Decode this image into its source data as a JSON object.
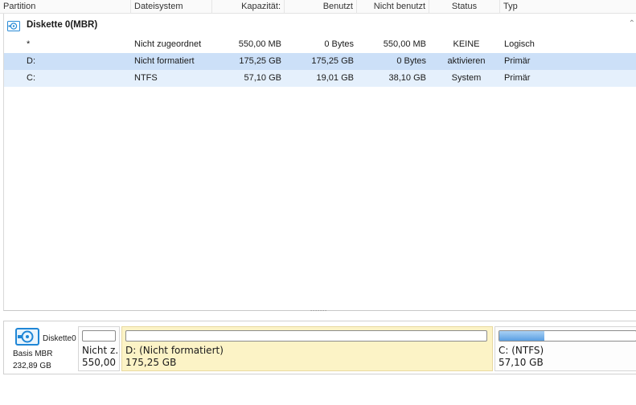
{
  "columns": [
    "Partition",
    "Dateisystem",
    "Kapazität:",
    "Benutzt",
    "Nicht benutzt",
    "Status",
    "Typ"
  ],
  "disk": {
    "title": "Diskette 0(MBR)",
    "icon": "disk-icon",
    "collapse_glyph": "⌃"
  },
  "rows": [
    {
      "partition": "*",
      "filesystem": "Nicht zugeordnet",
      "capacity": "550,00 MB",
      "used": "0 Bytes",
      "free": "550,00 MB",
      "status": "KEINE",
      "type": "Logisch"
    },
    {
      "partition": "D:",
      "filesystem": "Nicht formatiert",
      "capacity": "175,25 GB",
      "used": "175,25 GB",
      "free": "0 Bytes",
      "status": "aktivieren",
      "type": "Primär"
    },
    {
      "partition": "C:",
      "filesystem": "NTFS",
      "capacity": "57,10 GB",
      "used": "19,01 GB",
      "free": "38,10 GB",
      "status": "System",
      "type": "Primär"
    }
  ],
  "splitter": "˙˙˙˙˙˙˙",
  "diskmap": {
    "name": "Diskette0",
    "type": "Basis MBR",
    "size": "232,89 GB",
    "partitions": [
      {
        "label": "Nicht z...",
        "size": "550,00 ...",
        "used_fraction": 0.0
      },
      {
        "label": "D: (Nicht formatiert)",
        "size": "175,25 GB",
        "used_fraction": 0.0
      },
      {
        "label": "C: (NTFS)",
        "size": "57,10 GB",
        "used_fraction": 0.33
      }
    ]
  },
  "colors": {
    "selected_row": "#cce0f8",
    "alt_row": "#e5f0fc",
    "selected_block": "#fcf3c6",
    "usage_fill": "#5a9fe2"
  }
}
